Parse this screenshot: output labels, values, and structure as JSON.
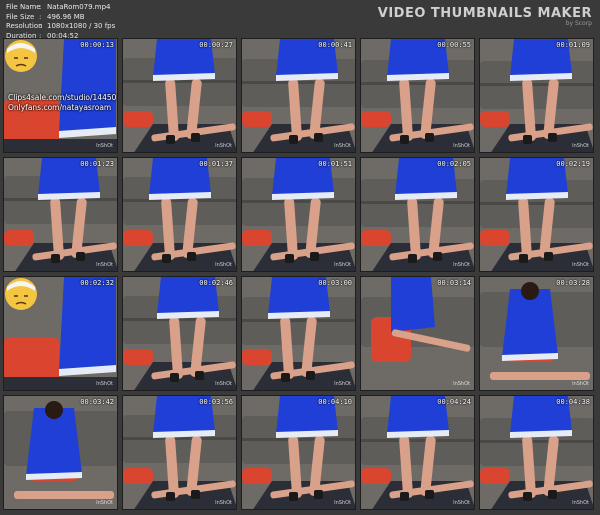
{
  "file_info": {
    "rows": [
      {
        "label": "File Name",
        "value": "NataRom079.mp4"
      },
      {
        "label": "File Size",
        "value": "496.96 MB"
      },
      {
        "label": "Resolution",
        "value": "1080x1080 / 30 fps"
      },
      {
        "label": "Duration",
        "value": "00:04:52"
      }
    ],
    "separator": ":"
  },
  "brand": {
    "title": "VIDEO THUMBNAILS MAKER",
    "by": "by Scorp"
  },
  "watermark_text": "InShOt",
  "promo_lines": [
    "Clips4sale.com/studio/14450",
    "Onlyfans.com/natayasroam"
  ],
  "thumbnails": [
    {
      "time": "00:00:13",
      "scene": "intro"
    },
    {
      "time": "00:00:27",
      "scene": "standing"
    },
    {
      "time": "00:00:41",
      "scene": "standing"
    },
    {
      "time": "00:00:55",
      "scene": "standing"
    },
    {
      "time": "00:01:09",
      "scene": "standing"
    },
    {
      "time": "00:01:23",
      "scene": "standing"
    },
    {
      "time": "00:01:37",
      "scene": "standing"
    },
    {
      "time": "00:01:51",
      "scene": "standing"
    },
    {
      "time": "00:02:05",
      "scene": "standing"
    },
    {
      "time": "00:02:19",
      "scene": "standing"
    },
    {
      "time": "00:02:32",
      "scene": "intro-face"
    },
    {
      "time": "00:02:46",
      "scene": "standing"
    },
    {
      "time": "00:03:00",
      "scene": "standing"
    },
    {
      "time": "00:03:14",
      "scene": "close"
    },
    {
      "time": "00:03:28",
      "scene": "sitting"
    },
    {
      "time": "00:03:42",
      "scene": "sitting"
    },
    {
      "time": "00:03:56",
      "scene": "standing"
    },
    {
      "time": "00:04:10",
      "scene": "standing"
    },
    {
      "time": "00:04:24",
      "scene": "standing"
    },
    {
      "time": "00:04:38",
      "scene": "standing"
    }
  ],
  "colors": {
    "background": "#3a3a3a",
    "dress_blue": "#1f3fd6",
    "trim_white": "#e6ecf5",
    "sofa_gray": "#5f5d5a",
    "floor_mat": "#2b2e36",
    "shirt_red": "#d9452f",
    "skin": "#d9a08a",
    "emoji_yellow": "#f4c542"
  }
}
